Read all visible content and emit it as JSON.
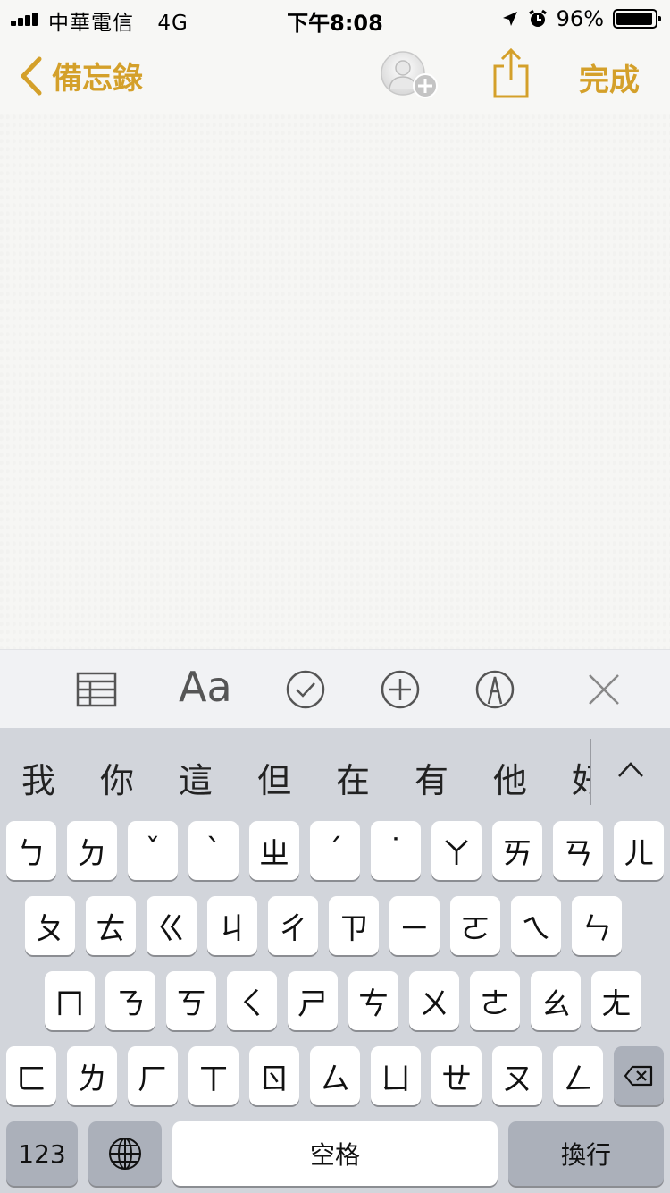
{
  "status": {
    "carrier": "中華電信",
    "network": "4G",
    "time": "下午8:08",
    "battery": "96%"
  },
  "nav": {
    "back_label": "備忘錄",
    "done_label": "完成"
  },
  "toolbar": {
    "format_label": "Aa",
    "icons": [
      "table-icon",
      "format-icon",
      "checklist-icon",
      "add-icon",
      "markup-icon",
      "close-icon"
    ]
  },
  "keyboard": {
    "candidates": [
      "我",
      "你",
      "這",
      "但",
      "在",
      "有",
      "他",
      "好"
    ],
    "row1": [
      "ㄅ",
      "ㄉ",
      "ˇ",
      "ˋ",
      "ㄓ",
      "ˊ",
      "˙",
      "ㄚ",
      "ㄞ",
      "ㄢ",
      "ㄦ"
    ],
    "row2": [
      "ㄆ",
      "ㄊ",
      "ㄍ",
      "ㄐ",
      "ㄔ",
      "ㄗ",
      "ㄧ",
      "ㄛ",
      "ㄟ",
      "ㄣ"
    ],
    "row3": [
      "ㄇ",
      "ㄋ",
      "ㄎ",
      "ㄑ",
      "ㄕ",
      "ㄘ",
      "ㄨ",
      "ㄜ",
      "ㄠ",
      "ㄤ"
    ],
    "row4": [
      "ㄈ",
      "ㄌ",
      "ㄏ",
      "ㄒ",
      "ㄖ",
      "ㄙ",
      "ㄩ",
      "ㄝ",
      "ㄡ",
      "ㄥ"
    ],
    "numbers_label": "123",
    "space_label": "空格",
    "return_label": "換行"
  },
  "colors": {
    "accent": "#d4a02a",
    "keyboard_bg": "#d2d5db",
    "toolbar_icon": "#555555"
  }
}
